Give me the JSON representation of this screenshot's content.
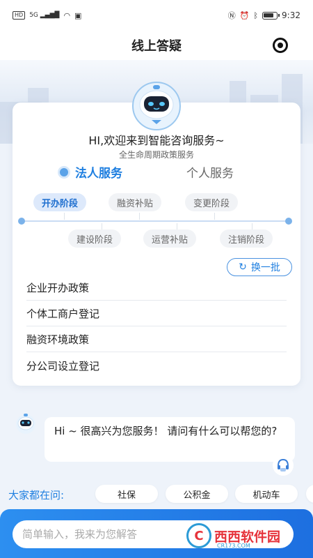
{
  "status_bar": {
    "network_badge": "HD",
    "signal": "5G",
    "time": "9:32"
  },
  "header": {
    "title": "线上答疑"
  },
  "card": {
    "greeting": "HI,欢迎来到智能咨询服务~",
    "subtitle": "全生命周期政策服务",
    "tabs": [
      {
        "label": "法人服务",
        "active": true
      },
      {
        "label": "个人服务",
        "active": false
      }
    ],
    "stages_top": [
      {
        "label": "开办阶段",
        "active": true
      },
      {
        "label": "融资补贴",
        "active": false
      },
      {
        "label": "变更阶段",
        "active": false
      }
    ],
    "stages_bottom": [
      {
        "label": "建设阶段"
      },
      {
        "label": "运营补贴"
      },
      {
        "label": "注销阶段"
      }
    ],
    "refresh_label": "换一批",
    "questions": [
      "企业开办政策",
      "个体工商户登记",
      "融资环境政策",
      "分公司设立登记"
    ]
  },
  "chat": {
    "bot_message": "Hi ~ 很高兴为您服务！ 请问有什么可以帮您的?"
  },
  "popular": {
    "label": "大家都在问:",
    "chips": [
      "社保",
      "公积金",
      "机动车"
    ]
  },
  "input": {
    "placeholder": "简单输入，我来为您解答"
  },
  "watermark": {
    "brand": "西西软件园",
    "site": "CR173.COM"
  },
  "colors": {
    "accent": "#1f7fe0",
    "bottom_bar": "#2d8ff0"
  }
}
